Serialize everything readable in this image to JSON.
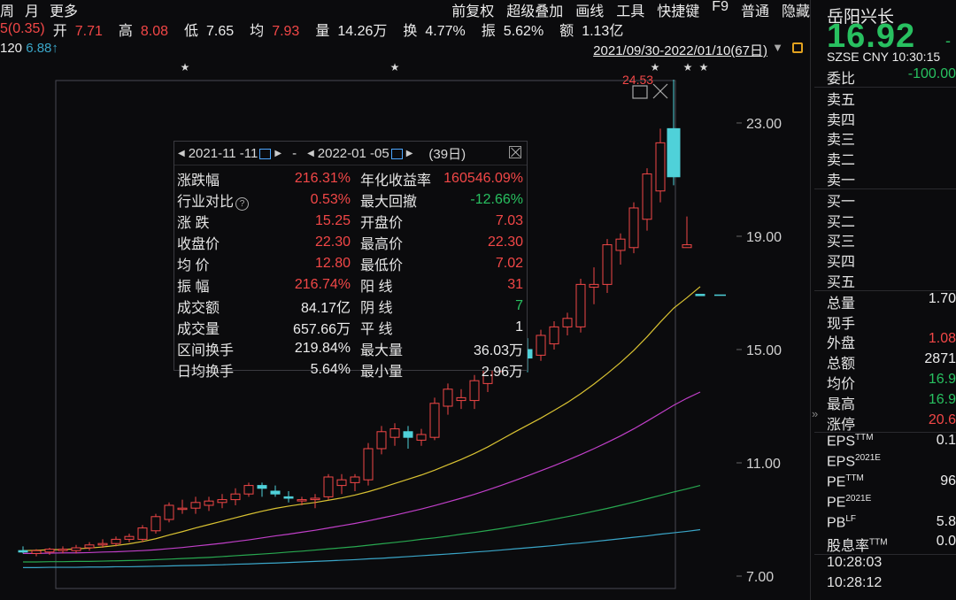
{
  "toolbar": {
    "left": [
      "周",
      "月",
      "更多"
    ],
    "right": [
      "前复权",
      "超级叠加",
      "画线",
      "工具",
      "快捷键",
      "F9",
      "普通",
      "隐藏"
    ]
  },
  "quote_bar": {
    "chg": "5(0.35)",
    "open_label": "开",
    "open": "7.71",
    "high_label": "高",
    "high": "8.08",
    "low_label": "低",
    "low": "7.65",
    "avg_label": "均",
    "avg": "7.93",
    "vol_label": "量",
    "vol": "14.26万",
    "turn_label": "换",
    "turn": "4.77%",
    "amp_label": "振",
    "amp": "5.62%",
    "amt_label": "额",
    "amt": "1.13亿"
  },
  "ma_line": {
    "label": "120",
    "value": "6.88↑"
  },
  "date_range": {
    "text": "2021/09/30-2022/01/10(67日)",
    "toggle": "▼"
  },
  "chart_data": {
    "type": "candlestick",
    "ylim": [
      7.0,
      24.53
    ],
    "y_ticks": [
      "23.00",
      "19.00",
      "15.00",
      "11.00",
      "7.00"
    ],
    "peak_label": "24.53",
    "candles": [
      {
        "o": 7.9,
        "h": 8.05,
        "l": 7.8,
        "c": 7.85
      },
      {
        "o": 7.8,
        "h": 7.95,
        "l": 7.7,
        "c": 7.9
      },
      {
        "o": 7.85,
        "h": 8.0,
        "l": 7.75,
        "c": 7.95
      },
      {
        "o": 7.9,
        "h": 8.05,
        "l": 7.8,
        "c": 7.95
      },
      {
        "o": 7.9,
        "h": 8.1,
        "l": 7.8,
        "c": 8.0
      },
      {
        "o": 8.0,
        "h": 8.2,
        "l": 7.9,
        "c": 8.1
      },
      {
        "o": 8.1,
        "h": 8.3,
        "l": 8.0,
        "c": 8.15
      },
      {
        "o": 8.15,
        "h": 8.4,
        "l": 8.05,
        "c": 8.3
      },
      {
        "o": 8.3,
        "h": 8.5,
        "l": 8.2,
        "c": 8.4
      },
      {
        "o": 8.3,
        "h": 8.8,
        "l": 8.2,
        "c": 8.7
      },
      {
        "o": 8.6,
        "h": 9.2,
        "l": 8.5,
        "c": 9.1
      },
      {
        "o": 9.0,
        "h": 9.6,
        "l": 8.9,
        "c": 9.5
      },
      {
        "o": 9.4,
        "h": 9.7,
        "l": 9.2,
        "c": 9.4
      },
      {
        "o": 9.4,
        "h": 9.8,
        "l": 9.2,
        "c": 9.6
      },
      {
        "o": 9.5,
        "h": 9.8,
        "l": 9.3,
        "c": 9.65
      },
      {
        "o": 9.6,
        "h": 9.9,
        "l": 9.4,
        "c": 9.7
      },
      {
        "o": 9.7,
        "h": 10.1,
        "l": 9.5,
        "c": 9.9
      },
      {
        "o": 9.9,
        "h": 10.3,
        "l": 9.8,
        "c": 10.2
      },
      {
        "o": 10.2,
        "h": 10.3,
        "l": 9.8,
        "c": 10.1
      },
      {
        "o": 10.0,
        "h": 10.2,
        "l": 9.8,
        "c": 9.9
      },
      {
        "o": 9.8,
        "h": 10.0,
        "l": 9.6,
        "c": 9.75
      },
      {
        "o": 9.7,
        "h": 9.8,
        "l": 9.5,
        "c": 9.7
      },
      {
        "o": 9.7,
        "h": 9.9,
        "l": 9.4,
        "c": 9.75
      },
      {
        "o": 9.8,
        "h": 10.6,
        "l": 9.7,
        "c": 10.5
      },
      {
        "o": 10.2,
        "h": 10.6,
        "l": 9.9,
        "c": 10.4
      },
      {
        "o": 10.3,
        "h": 10.6,
        "l": 10.0,
        "c": 10.5
      },
      {
        "o": 10.4,
        "h": 11.7,
        "l": 10.2,
        "c": 11.5
      },
      {
        "o": 11.5,
        "h": 12.3,
        "l": 11.3,
        "c": 12.1
      },
      {
        "o": 11.9,
        "h": 12.4,
        "l": 11.6,
        "c": 12.2
      },
      {
        "o": 12.1,
        "h": 12.3,
        "l": 11.5,
        "c": 11.9
      },
      {
        "o": 11.8,
        "h": 12.2,
        "l": 11.6,
        "c": 12.0
      },
      {
        "o": 11.9,
        "h": 13.3,
        "l": 11.8,
        "c": 13.1
      },
      {
        "o": 13.0,
        "h": 13.8,
        "l": 12.7,
        "c": 13.6
      },
      {
        "o": 13.2,
        "h": 13.6,
        "l": 12.9,
        "c": 13.3
      },
      {
        "o": 13.2,
        "h": 14.1,
        "l": 12.9,
        "c": 13.9
      },
      {
        "o": 13.8,
        "h": 14.6,
        "l": 13.5,
        "c": 14.5
      },
      {
        "o": 14.4,
        "h": 15.4,
        "l": 14.2,
        "c": 15.3
      },
      {
        "o": 15.2,
        "h": 15.6,
        "l": 14.6,
        "c": 15.0
      },
      {
        "o": 15.0,
        "h": 15.4,
        "l": 14.2,
        "c": 14.7
      },
      {
        "o": 14.8,
        "h": 15.7,
        "l": 14.6,
        "c": 15.5
      },
      {
        "o": 15.2,
        "h": 16.0,
        "l": 15.0,
        "c": 15.8
      },
      {
        "o": 15.8,
        "h": 16.3,
        "l": 15.5,
        "c": 16.1
      },
      {
        "o": 15.8,
        "h": 17.5,
        "l": 15.6,
        "c": 17.3
      },
      {
        "o": 17.2,
        "h": 17.9,
        "l": 16.6,
        "c": 17.3
      },
      {
        "o": 17.3,
        "h": 18.9,
        "l": 17.0,
        "c": 18.7
      },
      {
        "o": 18.5,
        "h": 19.1,
        "l": 18.0,
        "c": 18.9
      },
      {
        "o": 18.6,
        "h": 20.2,
        "l": 18.4,
        "c": 20.0
      },
      {
        "o": 19.6,
        "h": 21.4,
        "l": 19.2,
        "c": 21.2
      },
      {
        "o": 20.6,
        "h": 22.8,
        "l": 20.2,
        "c": 22.3
      },
      {
        "o": 22.8,
        "h": 24.53,
        "l": 20.8,
        "c": 21.1
      },
      {
        "o": 18.6,
        "h": 19.7,
        "l": 18.6,
        "c": 18.7
      },
      {
        "o": 16.95,
        "h": 16.95,
        "l": 16.92,
        "c": 16.92
      }
    ],
    "ma_lines": [
      {
        "color": "#d9c232",
        "values": [
          7.9,
          7.91,
          7.93,
          7.94,
          7.96,
          7.99,
          8.03,
          8.08,
          8.14,
          8.22,
          8.32,
          8.45,
          8.57,
          8.7,
          8.82,
          8.94,
          9.06,
          9.18,
          9.29,
          9.39,
          9.47,
          9.54,
          9.6,
          9.68,
          9.76,
          9.86,
          9.98,
          10.12,
          10.27,
          10.42,
          10.57,
          10.74,
          10.93,
          11.12,
          11.33,
          11.56,
          11.82,
          12.08,
          12.33,
          12.58,
          12.85,
          13.13,
          13.44,
          13.78,
          14.15,
          14.54,
          14.97,
          15.45,
          15.97,
          16.46,
          16.83,
          17.22
        ]
      },
      {
        "color": "#c03fc8",
        "values": [
          7.8,
          7.8,
          7.81,
          7.82,
          7.82,
          7.83,
          7.85,
          7.86,
          7.88,
          7.9,
          7.93,
          7.97,
          8.01,
          8.06,
          8.11,
          8.16,
          8.22,
          8.28,
          8.35,
          8.42,
          8.48,
          8.55,
          8.62,
          8.7,
          8.78,
          8.86,
          8.95,
          9.05,
          9.15,
          9.26,
          9.37,
          9.49,
          9.62,
          9.75,
          9.89,
          10.04,
          10.2,
          10.37,
          10.54,
          10.72,
          10.9,
          11.09,
          11.29,
          11.5,
          11.72,
          11.95,
          12.2,
          12.47,
          12.75,
          13.03,
          13.28,
          13.5
        ]
      },
      {
        "color": "#28a850",
        "values": [
          7.5,
          7.5,
          7.51,
          7.51,
          7.52,
          7.52,
          7.53,
          7.54,
          7.55,
          7.56,
          7.58,
          7.6,
          7.62,
          7.64,
          7.66,
          7.69,
          7.72,
          7.75,
          7.78,
          7.81,
          7.85,
          7.88,
          7.92,
          7.96,
          8.0,
          8.04,
          8.09,
          8.14,
          8.19,
          8.24,
          8.3,
          8.35,
          8.41,
          8.48,
          8.54,
          8.61,
          8.68,
          8.76,
          8.84,
          8.92,
          9.01,
          9.1,
          9.19,
          9.29,
          9.39,
          9.5,
          9.61,
          9.73,
          9.85,
          9.97,
          10.08,
          10.2
        ]
      },
      {
        "color": "#3aa6c8",
        "values": [
          7.3,
          7.3,
          7.31,
          7.31,
          7.31,
          7.32,
          7.32,
          7.33,
          7.33,
          7.34,
          7.35,
          7.36,
          7.37,
          7.38,
          7.39,
          7.4,
          7.42,
          7.43,
          7.45,
          7.46,
          7.48,
          7.5,
          7.52,
          7.54,
          7.56,
          7.58,
          7.61,
          7.63,
          7.66,
          7.69,
          7.72,
          7.75,
          7.78,
          7.81,
          7.85,
          7.88,
          7.92,
          7.96,
          8.0,
          8.04,
          8.08,
          8.13,
          8.17,
          8.22,
          8.27,
          8.32,
          8.37,
          8.42,
          8.48,
          8.53,
          8.58,
          8.64
        ]
      }
    ],
    "markers": [
      "★",
      "★",
      "★",
      "★",
      "★"
    ]
  },
  "stats_panel": {
    "start_date": "2021-11 -11",
    "dash": "-",
    "end_date": "2022-01 -05",
    "days": "(39日)",
    "rows": [
      {
        "l1": "涨跌幅",
        "v1": "216.31%",
        "c1": "red",
        "l2": "年化收益率",
        "v2": "160546.09%",
        "c2": "red"
      },
      {
        "l1": "行业对比",
        "help": "?",
        "v1": "0.53%",
        "c1": "red",
        "l2": "最大回撤",
        "v2": "-12.66%",
        "c2": "green"
      },
      {
        "l1": "涨    跌",
        "v1": "15.25",
        "c1": "red",
        "l2": "开盘价",
        "v2": "7.03",
        "c2": "red"
      },
      {
        "l1": "收盘价",
        "v1": "22.30",
        "c1": "red",
        "l2": "最高价",
        "v2": "22.30",
        "c2": "red"
      },
      {
        "l1": "均    价",
        "v1": "12.80",
        "c1": "red",
        "l2": "最低价",
        "v2": "7.02",
        "c2": "red"
      },
      {
        "l1": "振    幅",
        "v1": "216.74%",
        "c1": "red",
        "l2": "阳    线",
        "v2": "31",
        "c2": "red"
      },
      {
        "l1": "成交额",
        "v1": "84.17亿",
        "c1": "white",
        "l2": "阴    线",
        "v2": "7",
        "c2": "green"
      },
      {
        "l1": "成交量",
        "v1": "657.66万",
        "c1": "white",
        "l2": "平    线",
        "v2": "1",
        "c2": "white"
      },
      {
        "l1": "区间换手",
        "v1": "219.84%",
        "c1": "white",
        "l2": "最大量",
        "v2": "36.03万",
        "c2": "white"
      },
      {
        "l1": "日均换手",
        "v1": "5.64%",
        "c1": "white",
        "l2": "最小量",
        "v2": "2.96万",
        "c2": "white"
      }
    ]
  },
  "right_panel": {
    "name": "岳阳兴长",
    "price": "16.92",
    "change_dash": "-",
    "exchange": "SZSE  CNY  10:30:15",
    "weibi_label": "委比",
    "weibi": "-100.00",
    "asks": [
      "卖五",
      "卖四",
      "卖三",
      "卖二",
      "卖一"
    ],
    "bids": [
      "买一",
      "买二",
      "买三",
      "买四",
      "买五"
    ],
    "stats": [
      {
        "label": "总量",
        "value": "1.70",
        "color": "white"
      },
      {
        "label": "现手",
        "value": "",
        "color": "white"
      },
      {
        "label": "外盘",
        "value": "1.08",
        "color": "red"
      },
      {
        "label": "总额",
        "value": "2871",
        "color": "white"
      },
      {
        "label": "均价",
        "value": "16.9",
        "color": "green"
      },
      {
        "label": "最高",
        "value": "16.9",
        "color": "green"
      },
      {
        "label": "涨停",
        "value": "20.6",
        "color": "red"
      }
    ],
    "fund": [
      {
        "label": "EPS",
        "sup": "TTM",
        "value": "0.1"
      },
      {
        "label": "EPS",
        "sup": "2021E",
        "value": ""
      },
      {
        "label": "PE",
        "sup": "TTM",
        "value": "96"
      },
      {
        "label": "PE",
        "sup": "2021E",
        "value": ""
      },
      {
        "label": "PB",
        "sup": "LF",
        "value": "5.8"
      },
      {
        "label": "股息率",
        "sup": "TTM",
        "value": "0.0"
      }
    ],
    "times": [
      "10:28:03",
      "10:28:12"
    ],
    "expand": "»"
  },
  "colors": {
    "up": "#f24747",
    "down": "#28c060",
    "doji": "#4fd1d9",
    "bg": "#0b0b0d"
  }
}
